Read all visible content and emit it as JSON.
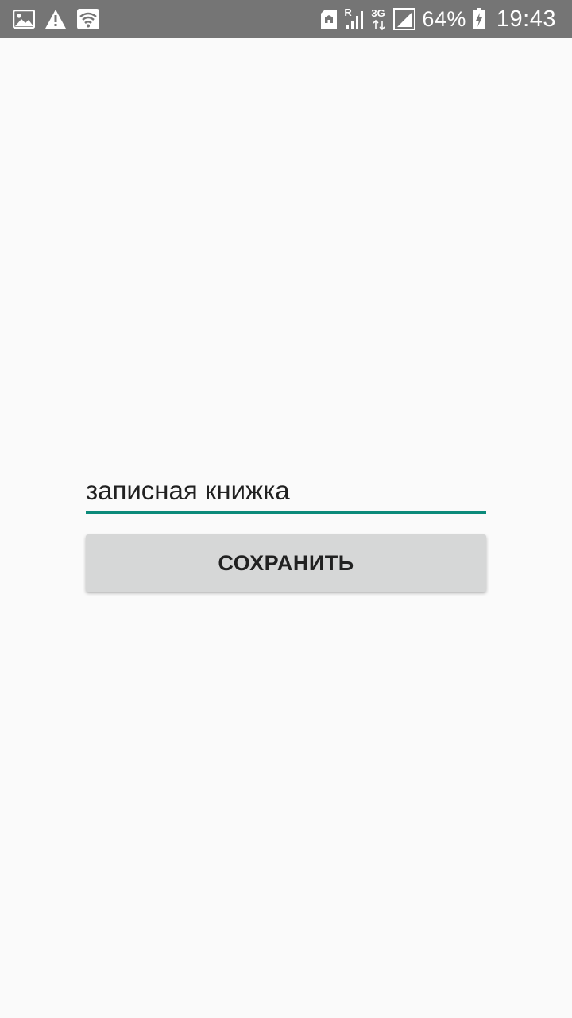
{
  "status_bar": {
    "left_icons": [
      "image-icon",
      "warning-icon",
      "wifi-icon"
    ],
    "right_icons": [
      "sd-card-icon",
      "roaming-signal-icon",
      "3g-data-icon",
      "signal-icon",
      "battery-charging-icon"
    ],
    "roaming_label": "R",
    "network_label": "3G",
    "battery_percent": "64%",
    "time": "19:43"
  },
  "form": {
    "input_value": "записная книжка",
    "save_label": "СОХРАНИТЬ"
  },
  "colors": {
    "accent": "#0b8a7a",
    "status_bar": "#757575",
    "background": "#fafafa",
    "button": "#d6d7d7"
  }
}
